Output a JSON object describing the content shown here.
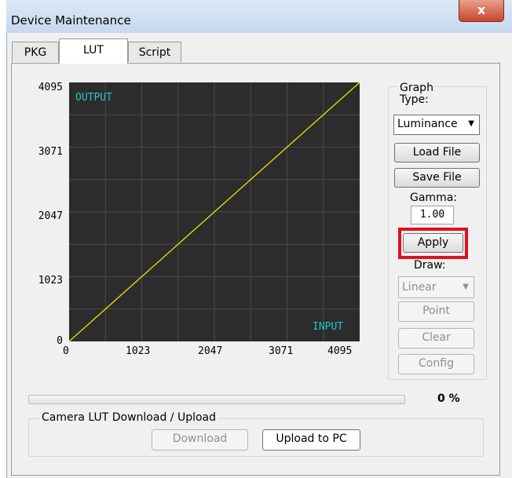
{
  "window": {
    "title": "Device Maintenance",
    "close_label": "x"
  },
  "tabs": [
    {
      "label": "PKG",
      "active": false
    },
    {
      "label": "LUT",
      "active": true
    },
    {
      "label": "Script",
      "active": false
    }
  ],
  "graph": {
    "output_label": "OUTPUT",
    "input_label": "INPUT",
    "y_ticks": [
      "4095",
      "3071",
      "2047",
      "1023",
      "0"
    ],
    "x_ticks": [
      "0",
      "1023",
      "2047",
      "3071",
      "4095"
    ]
  },
  "chart_data": {
    "type": "line",
    "x": [
      0,
      4095
    ],
    "y": [
      0,
      4095
    ],
    "xlim": [
      0,
      4095
    ],
    "ylim": [
      0,
      4095
    ],
    "xlabel": "INPUT",
    "ylabel": "OUTPUT",
    "grid": true,
    "line_color": "#e6e600",
    "background": "#2c2c2c"
  },
  "controls": {
    "graph_type_label": "Graph\nType:",
    "graph_type_value": "Luminance",
    "load_file": "Load File",
    "save_file": "Save File",
    "gamma_label": "Gamma:",
    "gamma_value": "1.00",
    "apply": "Apply",
    "draw_label": "Draw:",
    "draw_value": "Linear",
    "point": "Point",
    "clear": "Clear",
    "config": "Config"
  },
  "progress": {
    "value": 0,
    "text": "0 %"
  },
  "transfer": {
    "group_label": "Camera LUT Download / Upload",
    "download": "Download",
    "upload": "Upload to PC"
  },
  "colors": {
    "highlight": "#e0101c",
    "axis_label_cyan": "#27c5c5"
  }
}
